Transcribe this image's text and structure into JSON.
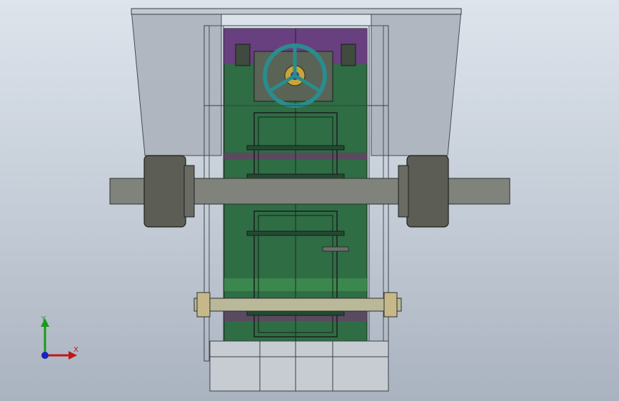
{
  "viewport": {
    "background_top": "#dde4ec",
    "background_bottom": "#a9b2bf"
  },
  "model": {
    "body_color": "#2e6b42",
    "hopper_color": "#b0b6be",
    "wheel_color": "#2a8c8c",
    "band_color": "#7a3e8e",
    "shaft_color": "#7c7f78",
    "bearing_color": "#5a5a54",
    "icon": "assembly-model"
  },
  "triad": {
    "y_label": "Y",
    "x_label": "X",
    "y_color": "#1a9a1a",
    "x_color": "#c01818",
    "z_color": "#1a22c0"
  }
}
